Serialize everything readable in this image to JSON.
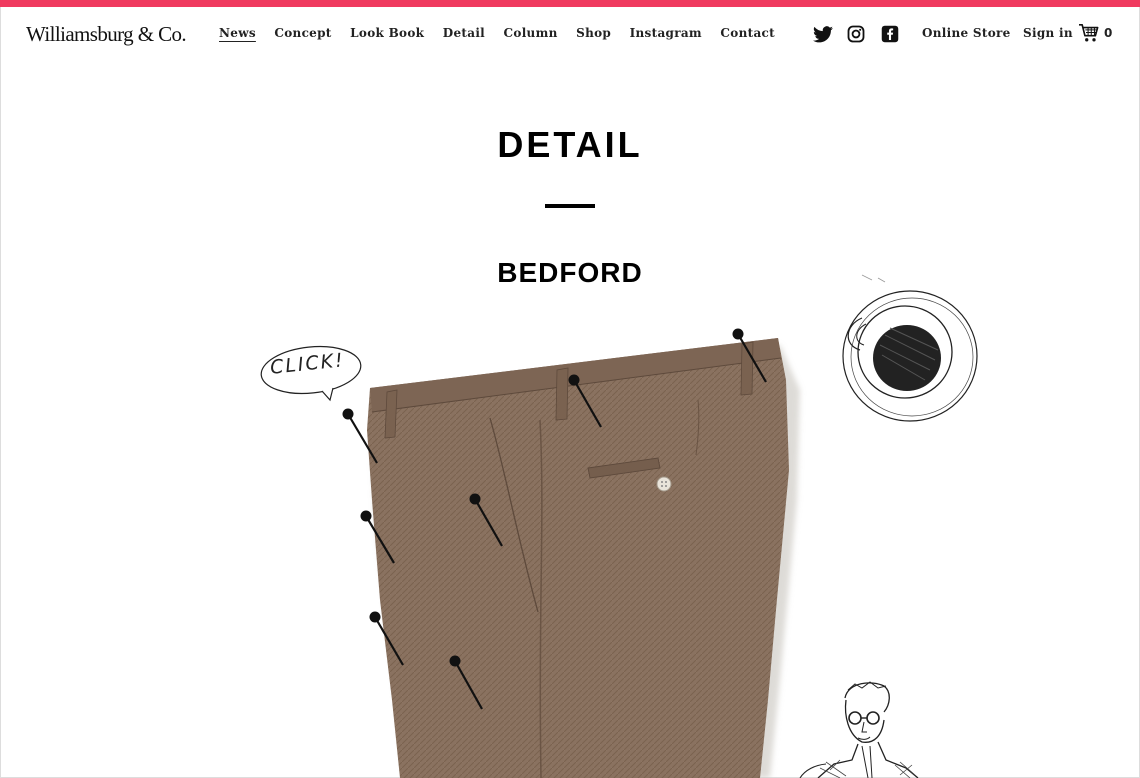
{
  "brand": {
    "logo_text": "Williamsburg & Co.",
    "accent_color": "#f03a5f"
  },
  "nav": {
    "items": [
      {
        "label": "News",
        "active": true
      },
      {
        "label": "Concept",
        "active": false
      },
      {
        "label": "Look Book",
        "active": false
      },
      {
        "label": "Detail",
        "active": false
      },
      {
        "label": "Column",
        "active": false
      },
      {
        "label": "Shop",
        "active": false
      },
      {
        "label": "Instagram",
        "active": false
      },
      {
        "label": "Contact",
        "active": false
      }
    ]
  },
  "header_right": {
    "social_icons": [
      "twitter-icon",
      "instagram-icon",
      "facebook-icon"
    ],
    "online_store_label": "Online Store",
    "sign_in_label": "Sign in",
    "cart_icon": "cart-icon",
    "cart_count": "0"
  },
  "main": {
    "page_title": "DETAIL",
    "product_name": "BEDFORD",
    "click_bubble_text": "CLICK!",
    "product_image": "brown-wool-trousers",
    "pins": [
      "waistband-pin",
      "back-pocket-pin",
      "side-seam-pin",
      "front-pocket-pin",
      "seam-pin-middle",
      "seam-pin-lower",
      "hem-pin",
      "belt-loop-pin"
    ],
    "illustrations": [
      "coffee-cup-illustration",
      "man-with-glasses-illustration"
    ],
    "fabric_color": "#8a7260"
  }
}
